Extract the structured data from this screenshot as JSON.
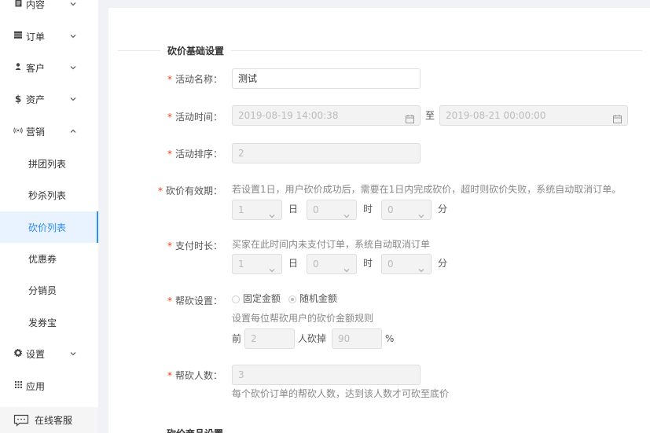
{
  "sidebar": {
    "items": [
      {
        "label": "内容",
        "icon": "document-icon"
      },
      {
        "label": "订单",
        "icon": "list-icon"
      },
      {
        "label": "客户",
        "icon": "user-icon"
      },
      {
        "label": "资产",
        "icon": "dollar-icon"
      },
      {
        "label": "营销",
        "icon": "broadcast-icon",
        "expanded": true
      },
      {
        "label": "设置",
        "icon": "gear-icon"
      },
      {
        "label": "应用",
        "icon": "apps-grid-icon"
      }
    ],
    "sub_items": [
      {
        "label": "拼团列表"
      },
      {
        "label": "秒杀列表"
      },
      {
        "label": "砍价列表",
        "active": true
      },
      {
        "label": "优惠券"
      },
      {
        "label": "分销员"
      },
      {
        "label": "发券宝"
      }
    ],
    "service": {
      "label": "在线客服",
      "icon": "chat-icon"
    }
  },
  "form": {
    "section_title": "砍价基础设置",
    "next_section_title": "砍价商品设置",
    "name": {
      "label": "活动名称：",
      "value": "测试"
    },
    "time": {
      "label": "活动时间：",
      "start": "2019-08-19 14:00:38",
      "separator": "至",
      "end": "2019-08-21 00:00:00"
    },
    "sort": {
      "label": "活动排序：",
      "value": "2"
    },
    "validity": {
      "label": "砍价有效期：",
      "hint": "若设置1日，用户砍价成功后，需要在1日内完成砍价，超时则砍价失败，系统自动取消订单。",
      "day": "1",
      "day_unit": "日",
      "hour": "0",
      "hour_unit": "时",
      "minute": "0",
      "minute_unit": "分"
    },
    "pay": {
      "label": "支付时长：",
      "hint": "买家在此时间内未支付订单，系统自动取消订单",
      "day": "1",
      "day_unit": "日",
      "hour": "0",
      "hour_unit": "时",
      "minute": "0",
      "minute_unit": "分"
    },
    "help": {
      "label": "帮砍设置：",
      "option_fixed": "固定金额",
      "option_random": "随机金额",
      "selected": "随机金额",
      "hint": "设置每位帮砍用户的砍价金额规则",
      "prefix": "前",
      "count": "2",
      "mid": "人砍掉",
      "percent": "90",
      "suffix": "%"
    },
    "people": {
      "label": "帮砍人数：",
      "value": "3",
      "hint": "每个砍价订单的帮砍人数，达到该人数才可砍至底价"
    }
  },
  "colors": {
    "accent": "#2d8cf0",
    "required": "#ed4014"
  }
}
